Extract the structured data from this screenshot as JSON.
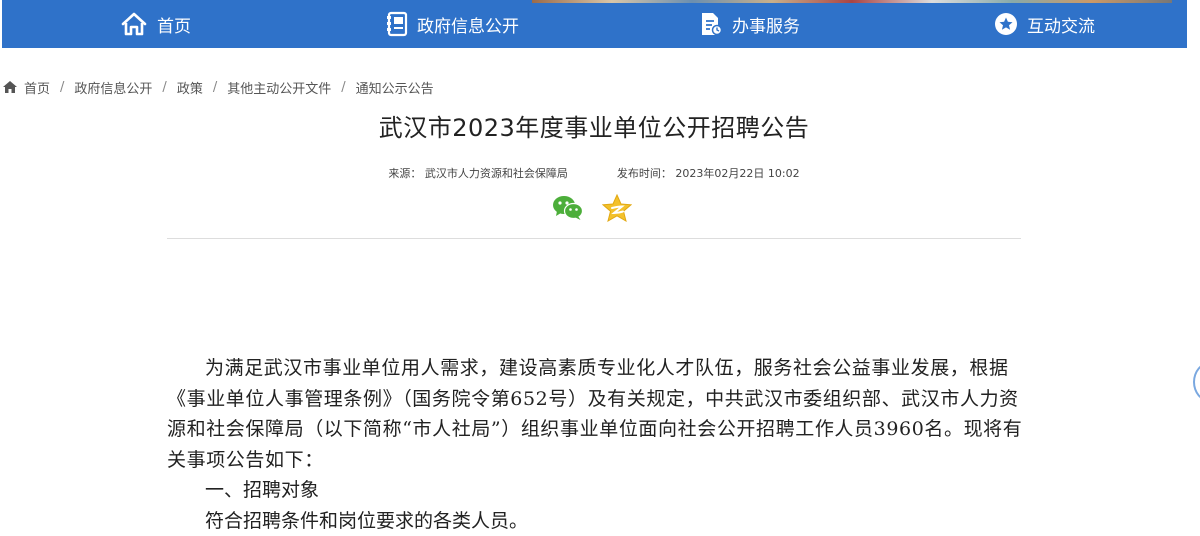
{
  "nav": {
    "home": "首页",
    "gov_info": "政府信息公开",
    "services": "办事服务",
    "interaction": "互动交流"
  },
  "breadcrumb": [
    "首页",
    "政府信息公开",
    "政策",
    "其他主动公开文件",
    "通知公示公告"
  ],
  "article": {
    "title": "武汉市2023年度事业单位公开招聘公告",
    "source_label": "来源：",
    "source": "武汉市人力资源和社会保障局",
    "time_label": "发布时间：",
    "time": "2023年02月22日 10:02"
  },
  "share": {
    "wechat_icon": "wechat-icon",
    "qzone_icon": "qzone-star-icon"
  },
  "content": {
    "para1": "为满足武汉市事业单位用人需求，建设高素质专业化人才队伍，服务社会公益事业发展，根据《事业单位人事管理条例》（国务院令第652号）及有关规定，中共武汉市委组织部、武汉市人力资源和社会保障局（以下简称“市人社局”）组织事业单位面向社会公开招聘工作人员3960名。现将有关事项公告如下：",
    "heading1": "一、招聘对象",
    "para2": "符合招聘条件和岗位要求的各类人员。"
  },
  "colors": {
    "nav_bg": "#2f72c9",
    "text": "#222222"
  }
}
